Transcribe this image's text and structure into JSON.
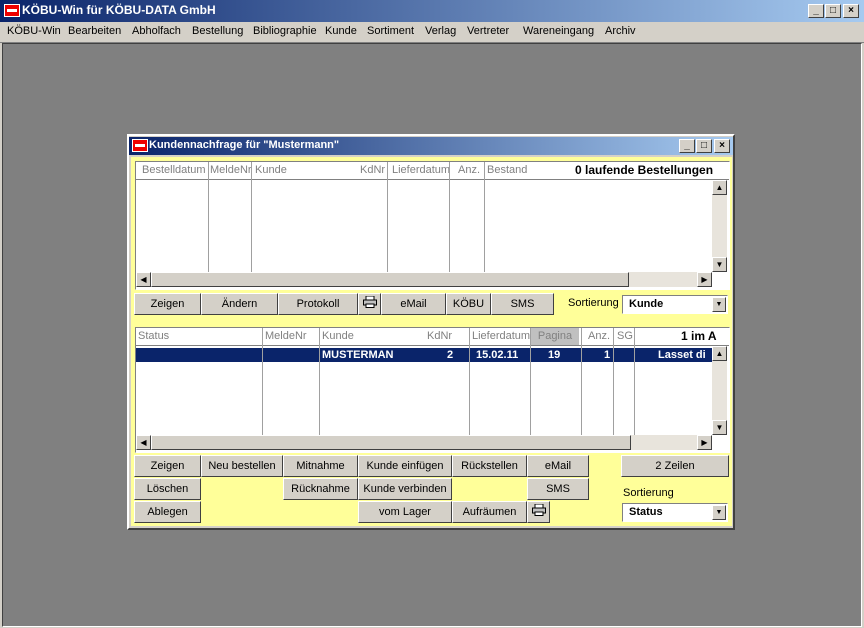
{
  "app": {
    "title": "KÖBU-Win für KÖBU-DATA GmbH"
  },
  "menu": [
    "KÖBU-Win",
    "Bearbeiten",
    "Abholfach",
    "Bestellung",
    "Bibliographie",
    "Kunde",
    "Sortiment",
    "Verlag",
    "Vertreter",
    "Wareneingang",
    "Archiv"
  ],
  "dialog": {
    "title": "Kundennachfrage für \"Mustermann\"",
    "orders": {
      "columns": [
        "Bestelldatum",
        "MeldeNr",
        "Kunde",
        "KdNr",
        "Lieferdatum",
        "Anz.",
        "Bestand"
      ],
      "summary": "0 laufende Bestellungen"
    },
    "toolbar1": {
      "buttons": [
        "Zeigen",
        "Ändern",
        "Protokoll",
        "eMail",
        "KÖBU",
        "SMS"
      ],
      "sort_label": "Sortierung",
      "sort_value": "Kunde"
    },
    "requests": {
      "columns": [
        "Status",
        "MeldeNr",
        "Kunde",
        "KdNr",
        "Lieferdatum",
        "Pagina",
        "Anz.",
        "SG"
      ],
      "summary": "1 im A",
      "rows": [
        {
          "status": "",
          "meldenr": "",
          "kunde": "MUSTERMAN",
          "kdnr": "2",
          "lieferdatum": "15.02.11",
          "pagina": "19",
          "anz": "1",
          "sg": "",
          "extra": "Lasset di"
        }
      ]
    },
    "actions": {
      "zeigen": "Zeigen",
      "neu_bestellen": "Neu bestellen",
      "mitnahme": "Mitnahme",
      "kunde_einfuegen": "Kunde einfügen",
      "rueckstellen": "Rückstellen",
      "email": "eMail",
      "zwei_zeilen": "2 Zeilen",
      "loeschen": "Löschen",
      "ruecknahme": "Rücknahme",
      "kunde_verbinden": "Kunde verbinden",
      "sms": "SMS",
      "ablegen": "Ablegen",
      "vom_lager": "vom Lager",
      "aufraeumen": "Aufräumen",
      "sort_label": "Sortierung",
      "sort_value": "Status"
    }
  }
}
